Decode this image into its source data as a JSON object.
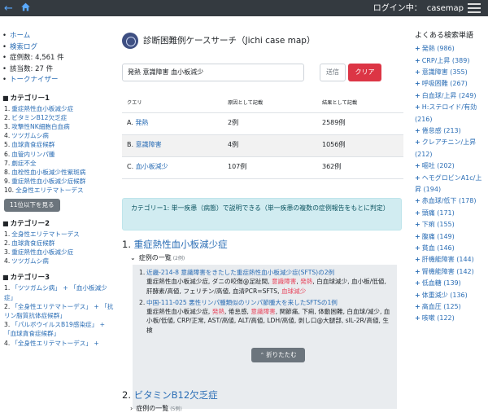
{
  "topbar": {
    "login_label": "ログイン中：",
    "user": "casemap"
  },
  "left": {
    "stats": [
      "ホーム",
      "検索ログ",
      "症例数: 4,561 件",
      "該当数: 27 件",
      "トークナイザー"
    ],
    "categories": [
      {
        "title": "カテゴリー1",
        "items": [
          "重症熱性血小板減少症",
          "ビタミンB12欠乏症",
          "攻撃性NK細胞白血病",
          "ツツガムシ病",
          "血球貪食症候群",
          "血管内リンパ腫",
          "劇症不全",
          "血栓性血小板減少性紫斑病",
          "重症熱性血小板減少症候群",
          "全身性エリテマトーデス"
        ]
      },
      {
        "title": "カテゴリー2",
        "items": [
          "全身性エリテマトーデス",
          "血球貪食症候群",
          "重症熱性血小板減少症",
          "ツツガムシ病"
        ]
      },
      {
        "title": "カテゴリー3",
        "items": [
          "「ツツガムシ病」 + 「血小板減少症」",
          "「全身性エリテマトーデス」 + 「抗リン脂質抗体症候群」",
          "「パルボウイルスB19感染症」 + 「血球貪食症候群」",
          "「全身性エリテマトーデス」 +"
        ]
      }
    ],
    "more_button": "11位以下を見る"
  },
  "main": {
    "title": "診断困難例ケースサーチ（Jichi case map）",
    "search_value": "発熱 意識障害 血小板減少",
    "send_label": "送信",
    "clear_label": "クリア",
    "table": {
      "headers": [
        "クエリ",
        "原因として記載",
        "結果として記載"
      ],
      "rows": [
        {
          "q_prefix": "A.",
          "q": "発熱",
          "cause": "2例",
          "result": "2589例"
        },
        {
          "q_prefix": "B.",
          "q": "意識障害",
          "cause": "4例",
          "result": "1056例"
        },
        {
          "q_prefix": "C.",
          "q": "血小板減少",
          "cause": "107例",
          "result": "362例"
        }
      ]
    },
    "alert": "カテゴリー1: 単一疾患（病態）で説明できる（単一疾患の複数の症例報告をもとに判定）",
    "sections": [
      {
        "num": "1.",
        "title": "重症熱性血小板減少症",
        "list_label": "症例の一覧",
        "count": "(2例)",
        "cases": [
          {
            "idx": "1.",
            "title": "近畿-214-8 意識障害をきたした重症熱性血小板減少症(SFTS)の2例",
            "body_1": "重症熱性血小板減少症, ダニの咬傷@足趾間, ",
            "hl_1": "意識障害",
            "sep_1": ", ",
            "hl_2": "発熱",
            "body_2": ", 白血球減少, 血小板/低値, 肝酵素/高値, フェリチン/高値, 血清PCR=SFTS, ",
            "hl_3": "血球減少"
          },
          {
            "idx": "2.",
            "title": "中国-111-025 悪性リンパ腫類似のリンパ節腫大を来したSFTSの1例",
            "body_1": "重症熱性血小板減少症, ",
            "hl_1": "発熱",
            "sep_1": ", 倦怠感, ",
            "hl_2": "意識障害",
            "body_2": ", 関節痛, 下痢, 体動困難, 白血球/減少, 血小板/低値, CRP/正常, AST/高値, ALT/高値, LDH/高値, 剥し口@大腿部, sIL-2R/高値, 生検",
            "hl_3": ""
          }
        ],
        "fold_label": "折りたたむ"
      },
      {
        "num": "2.",
        "title": "ビタミンB12欠乏症",
        "list_label": "症例の一覧",
        "count": "(5例)"
      }
    ]
  },
  "right": {
    "title": "よくある検索単語",
    "items": [
      {
        "label": "発熱",
        "count": "(986)"
      },
      {
        "label": "CRP/上昇",
        "count": "(389)"
      },
      {
        "label": "意識障害",
        "count": "(355)"
      },
      {
        "label": "呼吸困難",
        "count": "(267)"
      },
      {
        "label": "白血球/上昇",
        "count": "(249)"
      },
      {
        "label": "H:ステロイド/有効",
        "count": "(216)"
      },
      {
        "label": "倦怠感",
        "count": "(213)"
      },
      {
        "label": "クレアチニン/上昇",
        "count": "(212)"
      },
      {
        "label": "嘔吐",
        "count": "(202)"
      },
      {
        "label": "ヘモグロビンA1c/上昇",
        "count": "(194)"
      },
      {
        "label": "赤血球/低下",
        "count": "(178)"
      },
      {
        "label": "頭痛",
        "count": "(171)"
      },
      {
        "label": "下痢",
        "count": "(155)"
      },
      {
        "label": "腹痛",
        "count": "(149)"
      },
      {
        "label": "貧血",
        "count": "(146)"
      },
      {
        "label": "肝機能障害",
        "count": "(144)"
      },
      {
        "label": "腎機能障害",
        "count": "(142)"
      },
      {
        "label": "低血糖",
        "count": "(139)"
      },
      {
        "label": "体重減少",
        "count": "(136)"
      },
      {
        "label": "高血圧",
        "count": "(125)"
      },
      {
        "label": "咳嗽",
        "count": "(122)"
      }
    ]
  }
}
